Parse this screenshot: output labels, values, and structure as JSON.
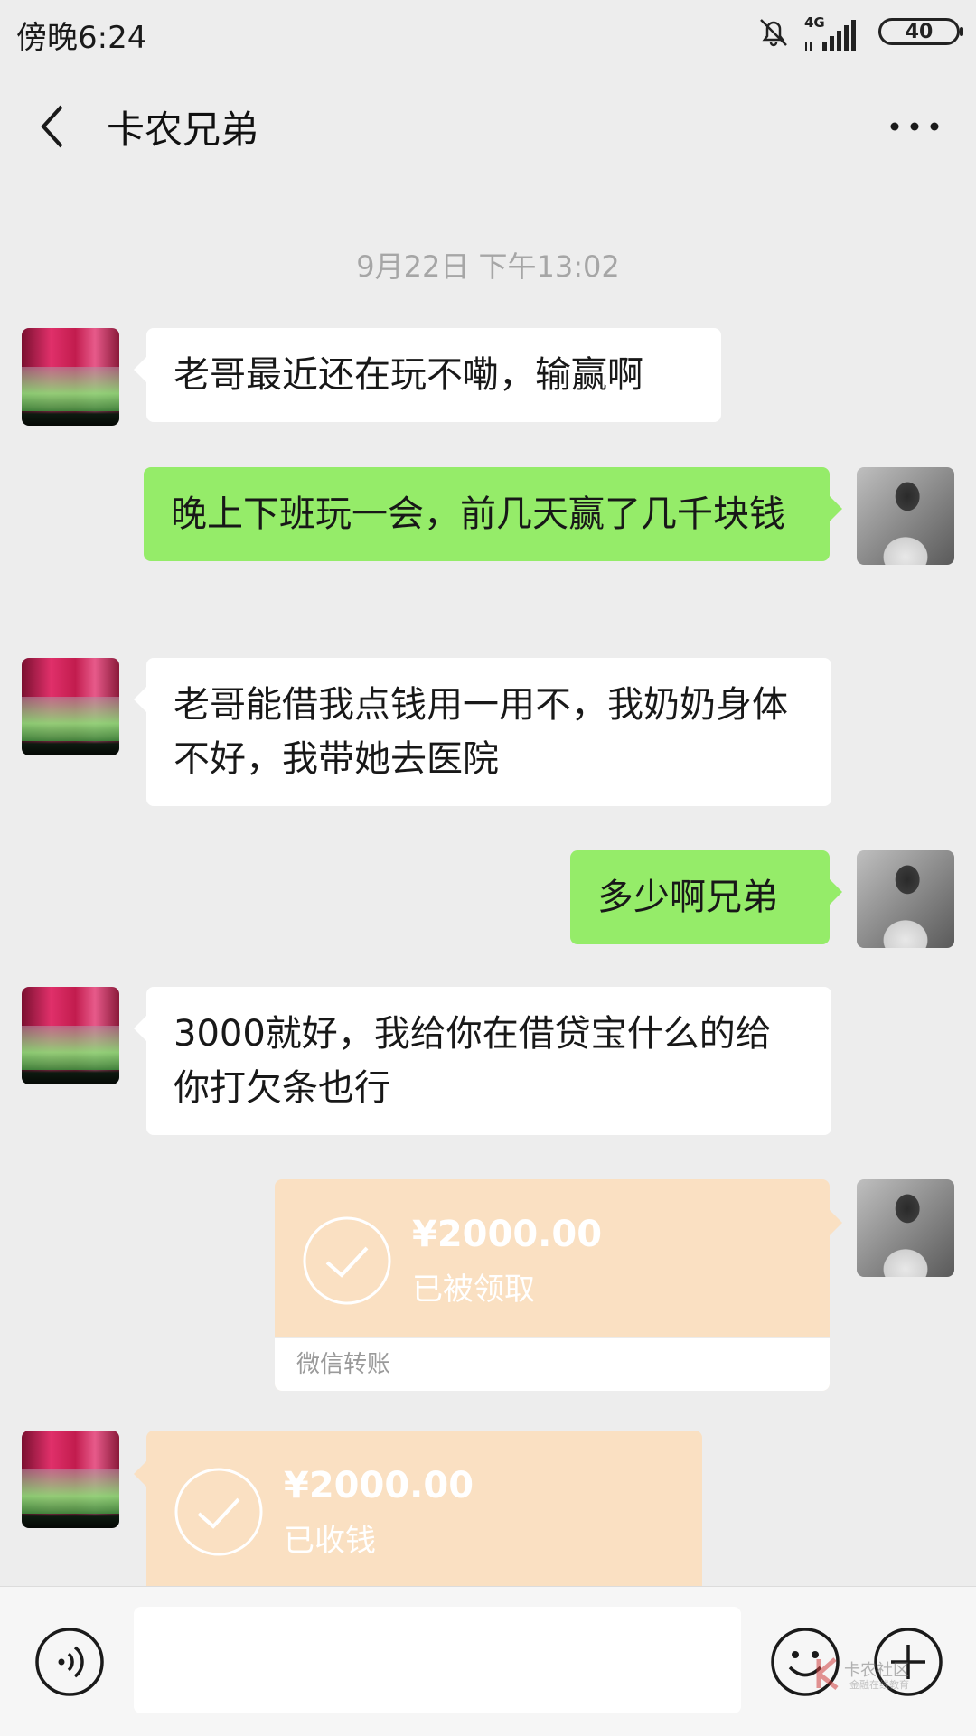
{
  "status_bar": {
    "time": "傍晚6:24",
    "network": "4G",
    "battery": "40"
  },
  "header": {
    "title": "卡农兄弟"
  },
  "timestamp": "9月22日 下午13:02",
  "messages": [
    {
      "side": "left",
      "text": "老哥最近还在玩不嘞，输赢啊"
    },
    {
      "side": "right",
      "text": "晚上下班玩一会，前几天赢了几千块钱"
    },
    {
      "side": "left",
      "text": "老哥能借我点钱用一用不，我奶奶身体不好，我带她去医院"
    },
    {
      "side": "right",
      "text": "多少啊兄弟"
    },
    {
      "side": "left",
      "text": "3000就好，我给你在借贷宝什么的给你打欠条也行"
    }
  ],
  "transfers": [
    {
      "side": "right",
      "amount": "¥2000.00",
      "status": "已被领取",
      "footer": "微信转账"
    },
    {
      "side": "left",
      "amount": "¥2000.00",
      "status": "已收钱"
    }
  ],
  "input_bar": {
    "placeholder": ""
  },
  "watermark": {
    "text": "卡农社区",
    "sub": "金融在线教育"
  },
  "colors": {
    "self_bubble": "#95ec69",
    "other_bubble": "#ffffff",
    "transfer": "#fae0c2",
    "background": "#ededed"
  }
}
